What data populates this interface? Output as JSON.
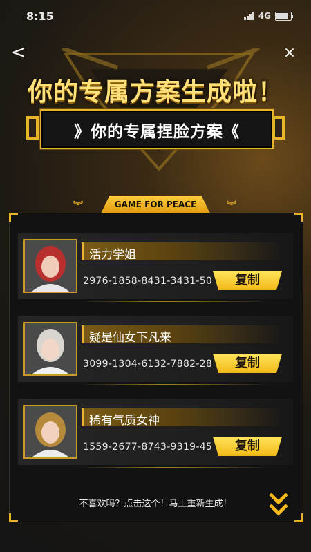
{
  "status_bar": {
    "time": "8:15",
    "network": "4G"
  },
  "nav": {
    "back_icon": "<",
    "close_icon": "×"
  },
  "banner": {
    "headline": "你的专属方案生成啦！",
    "subtitle": "》你的专属捏脸方案《",
    "badge": "GAME FOR PEACE"
  },
  "plans": [
    {
      "name": "活力学姐",
      "code": "2976-1858-8431-3431-50",
      "copy_label": "复制",
      "hair_color": "#b8302e"
    },
    {
      "name": "疑是仙女下凡来",
      "code": "3099-1304-6132-7882-28",
      "copy_label": "复制",
      "hair_color": "#d9d6d0"
    },
    {
      "name": "稀有气质女神",
      "code": "1559-2677-8743-9319-45",
      "copy_label": "复制",
      "hair_color": "#b58a3a"
    }
  ],
  "footer": {
    "regenerate_text": "不喜欢吗？点击这个！马上重新生成！"
  },
  "colors": {
    "accent": "#e8b52a",
    "button": "#f3b817",
    "panel": "#121212"
  }
}
